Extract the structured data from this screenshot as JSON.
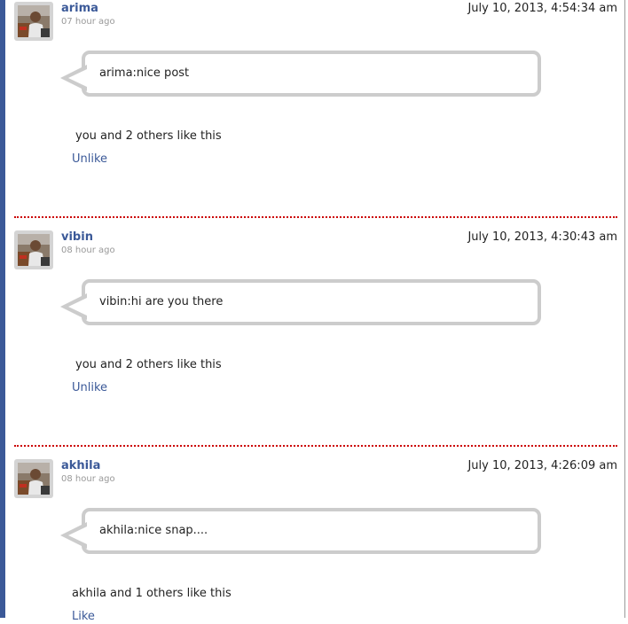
{
  "posts": [
    {
      "author": "arima",
      "ago": "07 hour ago",
      "timestamp": "July 10, 2013, 4:54:34 am",
      "message": "arima:nice post",
      "likes": "you and 2 others like this",
      "like_action": "Unlike"
    },
    {
      "author": "vibin",
      "ago": "08 hour ago",
      "timestamp": "July 10, 2013, 4:30:43 am",
      "message": "vibin:hi are you there",
      "likes": "you and 2 others like this",
      "like_action": "Unlike"
    },
    {
      "author": "akhila",
      "ago": "08 hour ago",
      "timestamp": "July 10, 2013, 4:26:09 am",
      "message": "akhila:nice snap....",
      "likes": "akhila and 1 others like this",
      "like_action": "Like"
    }
  ],
  "colors": {
    "accent": "#3b5998",
    "divider": "#cc0000",
    "bubble_border": "#cccccc"
  },
  "icons": {
    "avatar": "user-photo-icon",
    "bubble_tail": "speech-tail-icon"
  }
}
